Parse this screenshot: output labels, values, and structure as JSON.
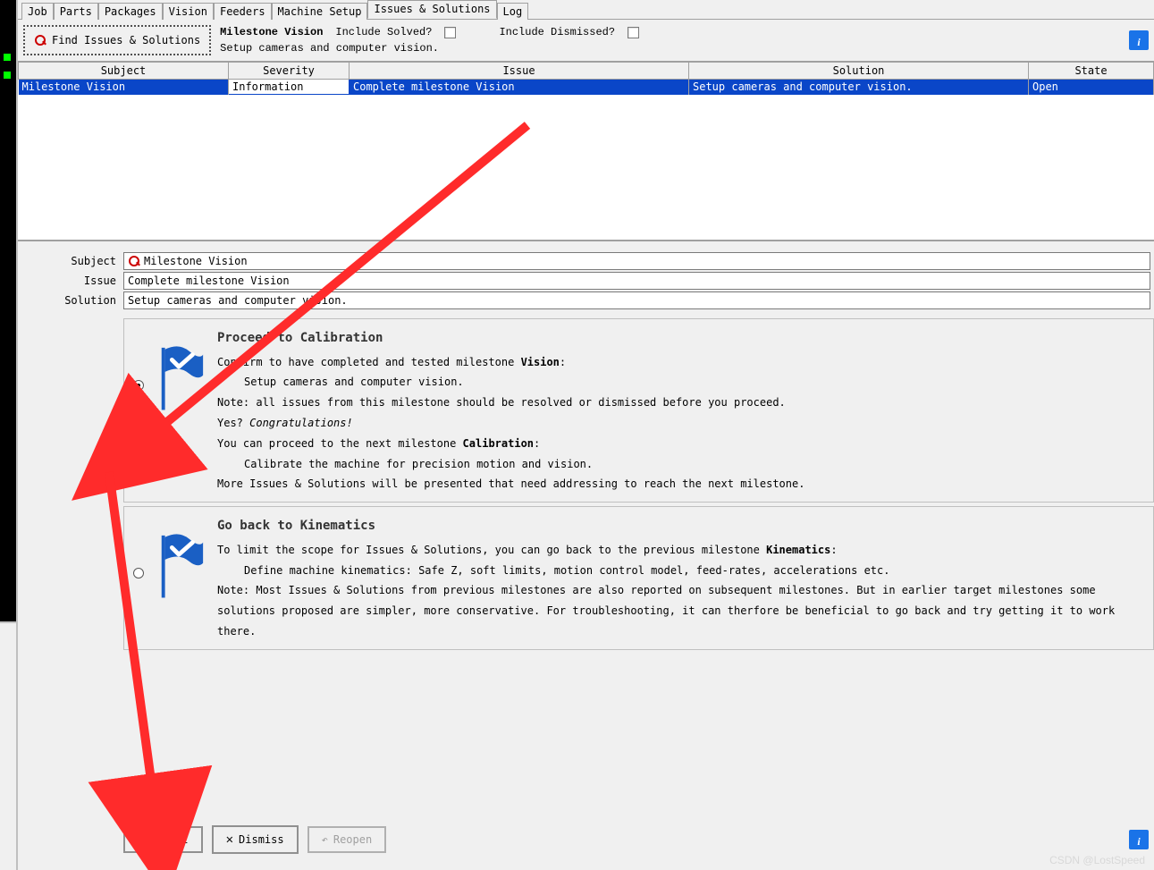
{
  "tabs": [
    "Job",
    "Parts",
    "Packages",
    "Vision",
    "Feeders",
    "Machine Setup",
    "Issues & Solutions",
    "Log"
  ],
  "active_tab": "Issues & Solutions",
  "find_button": "Find Issues & Solutions",
  "milestone": {
    "label": "Milestone",
    "value": "Vision",
    "desc": "Setup cameras and computer vision.",
    "include_solved": "Include Solved?",
    "include_dismissed": "Include Dismissed?"
  },
  "columns": {
    "subject": "Subject",
    "severity": "Severity",
    "issue": "Issue",
    "solution": "Solution",
    "state": "State"
  },
  "row": {
    "subject": "Milestone Vision",
    "severity": "Information",
    "issue": "Complete milestone Vision",
    "solution": "Setup cameras and computer vision.",
    "state": "Open"
  },
  "detail_labels": {
    "subject": "Subject",
    "issue": "Issue",
    "solution": "Solution"
  },
  "detail_values": {
    "subject": "Milestone Vision",
    "issue": "Complete milestone Vision",
    "solution": "Setup cameras and computer vision."
  },
  "option1": {
    "heading": "Proceed to Calibration",
    "l1a": "Confirm to have completed and tested milestone ",
    "l1b": "Vision",
    "l1c": ":",
    "l2": "Setup cameras and computer vision.",
    "l3": "Note: all issues from this milestone should be resolved or dismissed before you proceed.",
    "l4a": "Yes? ",
    "l4b": "Congratulations!",
    "l5a": "You can proceed to the next milestone ",
    "l5b": "Calibration",
    "l5c": ":",
    "l6": "Calibrate the machine for precision motion and vision.",
    "l7": "More Issues & Solutions will be presented that need addressing to reach the next milestone."
  },
  "option2": {
    "heading": "Go back to Kinematics",
    "l1a": "To limit the scope for Issues & Solutions, you can go back to the previous milestone ",
    "l1b": "Kinematics",
    "l1c": ":",
    "l2": "Define machine kinematics: Safe Z, soft limits, motion control model, feed-rates, accelerations etc.",
    "l3": "Note: Most Issues & Solutions from previous milestones are also reported on subsequent milestones. But in earlier target milestones some solutions proposed are simpler, more conservative. For troubleshooting, it can therfore be beneficial to go back and try getting it to work there."
  },
  "buttons": {
    "accept": "Accept",
    "dismiss": "Dismiss",
    "reopen": "Reopen"
  },
  "watermark": "CSDN @LostSpeed"
}
